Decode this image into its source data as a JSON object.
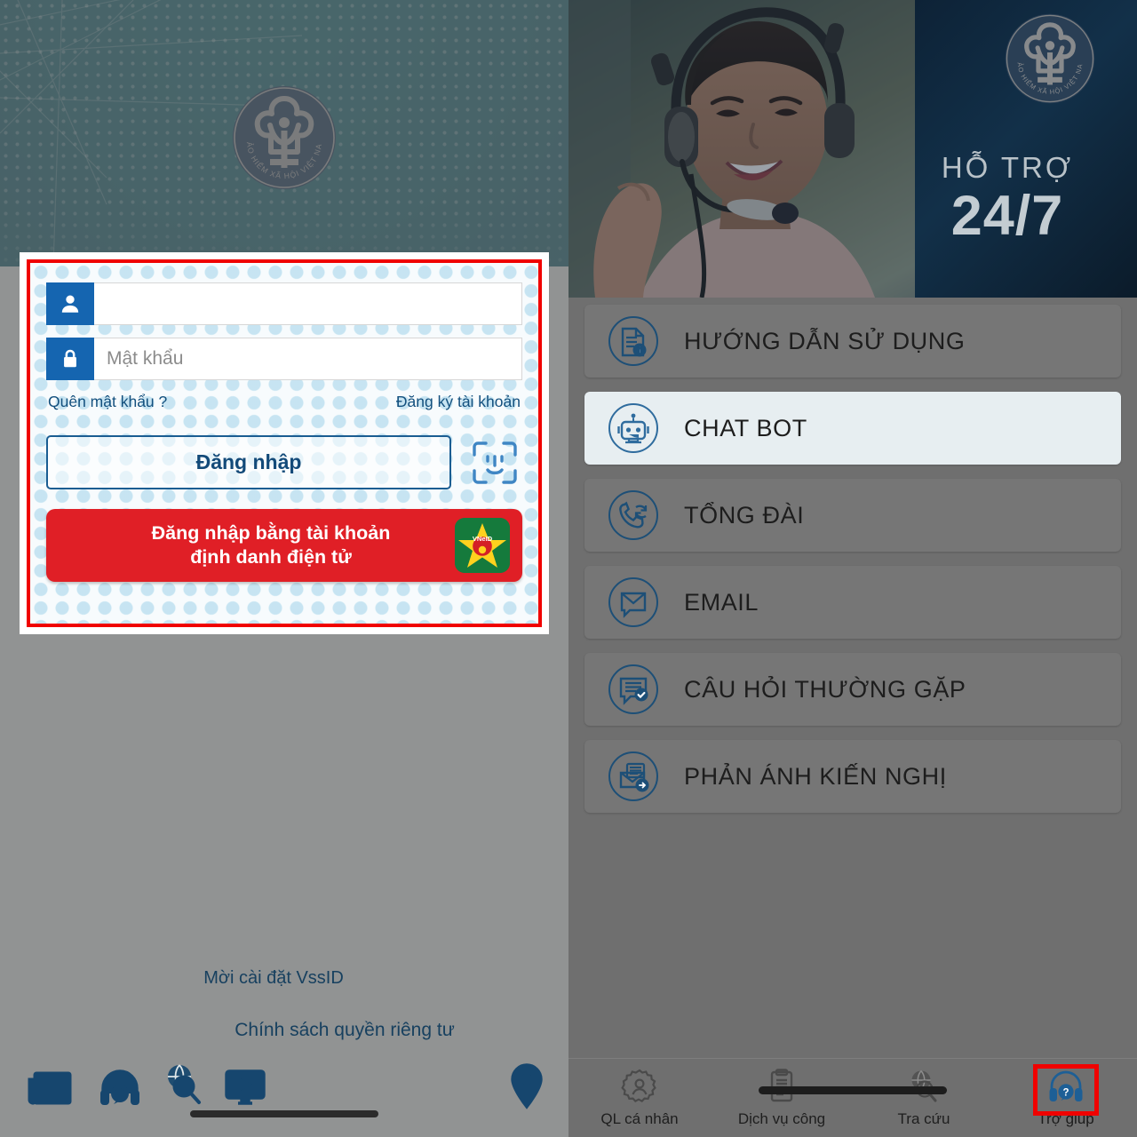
{
  "left_panel": {
    "logo_alt": "BẢO HIỂM XÃ HỘI VIỆT NAM",
    "login_form": {
      "username_value": "",
      "username_placeholder": "",
      "password_value": "",
      "password_placeholder": "Mật khẩu",
      "forgot_password": "Quên mật khẩu ?",
      "register": "Đăng ký tài khoản",
      "login_button": "Đăng nhập",
      "faceid_icon": "face-id-icon",
      "vneid_button_line1": "Đăng nhập bằng tài khoản",
      "vneid_button_line2": "định danh điện tử",
      "vneid_badge_text": "VNeID"
    },
    "footer": {
      "invite_install": "Mời cài đặt VssID",
      "privacy_policy": "Chính sách quyền riêng tư"
    },
    "bottom_icons": [
      {
        "name": "news-icon"
      },
      {
        "name": "headset-support-icon"
      },
      {
        "name": "globe-search-icon"
      },
      {
        "name": "video-player-icon"
      },
      {
        "name": "map-pin-icon"
      }
    ]
  },
  "right_panel": {
    "hero": {
      "logo_alt": "BẢO HIỂM XÃ HỘI VIỆT NAM",
      "support_label": "HỖ TRỢ",
      "support_hours": "24/7"
    },
    "menu_items": [
      {
        "label": "HƯỚNG DẪN SỬ DỤNG",
        "icon": "document-info-icon",
        "highlighted": false
      },
      {
        "label": "CHAT BOT",
        "icon": "robot-icon",
        "highlighted": true
      },
      {
        "label": "TỔNG ĐÀI",
        "icon": "phone-refresh-icon",
        "highlighted": false
      },
      {
        "label": "EMAIL",
        "icon": "envelope-chat-icon",
        "highlighted": false
      },
      {
        "label": "CÂU HỎI THƯỜNG GẶP",
        "icon": "faq-chat-check-icon",
        "highlighted": false
      },
      {
        "label": "PHẢN ÁNH KIẾN NGHỊ",
        "icon": "envelope-send-icon",
        "highlighted": false
      }
    ],
    "bottom_nav": [
      {
        "label": "QL cá nhân",
        "icon": "gear-person-icon",
        "selected": false
      },
      {
        "label": "Dịch vụ công",
        "icon": "clipboard-icon",
        "selected": false
      },
      {
        "label": "Tra cứu",
        "icon": "globe-search-icon",
        "selected": false
      },
      {
        "label": "Trợ giúp",
        "icon": "headset-help-icon",
        "selected": true
      }
    ]
  },
  "annotations": {
    "login_card_highlight_color": "#f00200",
    "chatbot_highlight_color": "#f00200",
    "help_tab_highlight_color": "#f00200"
  }
}
